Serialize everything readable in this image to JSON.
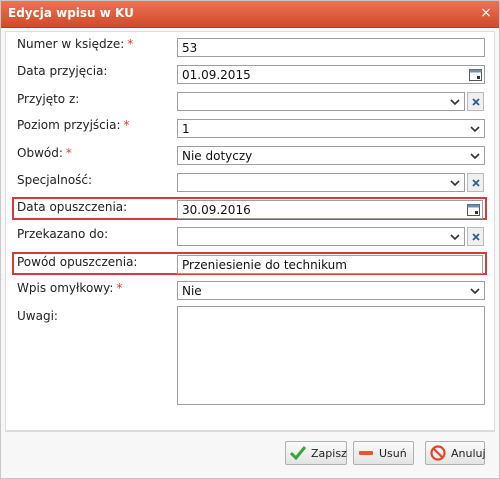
{
  "window": {
    "title": "Edycja wpisu w KU",
    "close_label": "×"
  },
  "colors": {
    "title_bar": "#e0603f",
    "required": "#e23a2a",
    "highlight_border": "#d63a3a"
  },
  "form": {
    "numer_label": "Numer w księdze:",
    "numer_value": "53",
    "data_przyjecia_label": "Data przyjęcia:",
    "data_przyjecia_value": "01.09.2015",
    "przyjeto_label": "Przyjęto z:",
    "przyjeto_value": "",
    "poziom_label": "Poziom przyjścia:",
    "poziom_value": "1",
    "obwod_label": "Obwód:",
    "obwod_value": "Nie dotyczy",
    "specjalnosc_label": "Specjalność:",
    "specjalnosc_value": "",
    "data_opuszczenia_label": "Data opuszczenia:",
    "data_opuszczenia_value": "30.09.2016",
    "przekazano_label": "Przekazano do:",
    "przekazano_value": "",
    "powod_label": "Powód opuszczenia:",
    "powod_value": "Przeniesienie do technikum",
    "wpis_label": "Wpis omyłkowy:",
    "wpis_value": "Nie",
    "uwagi_label": "Uwagi:",
    "uwagi_value": "",
    "required_mark": "*"
  },
  "icons": {
    "calendar": "calendar-icon",
    "dropdown": "chevron-down-icon",
    "clear": "clear-x-icon",
    "save": "check-icon",
    "delete": "minus-icon",
    "cancel": "no-entry-icon"
  },
  "buttons": {
    "save": "Zapisz",
    "delete": "Usuń",
    "cancel": "Anuluj"
  }
}
